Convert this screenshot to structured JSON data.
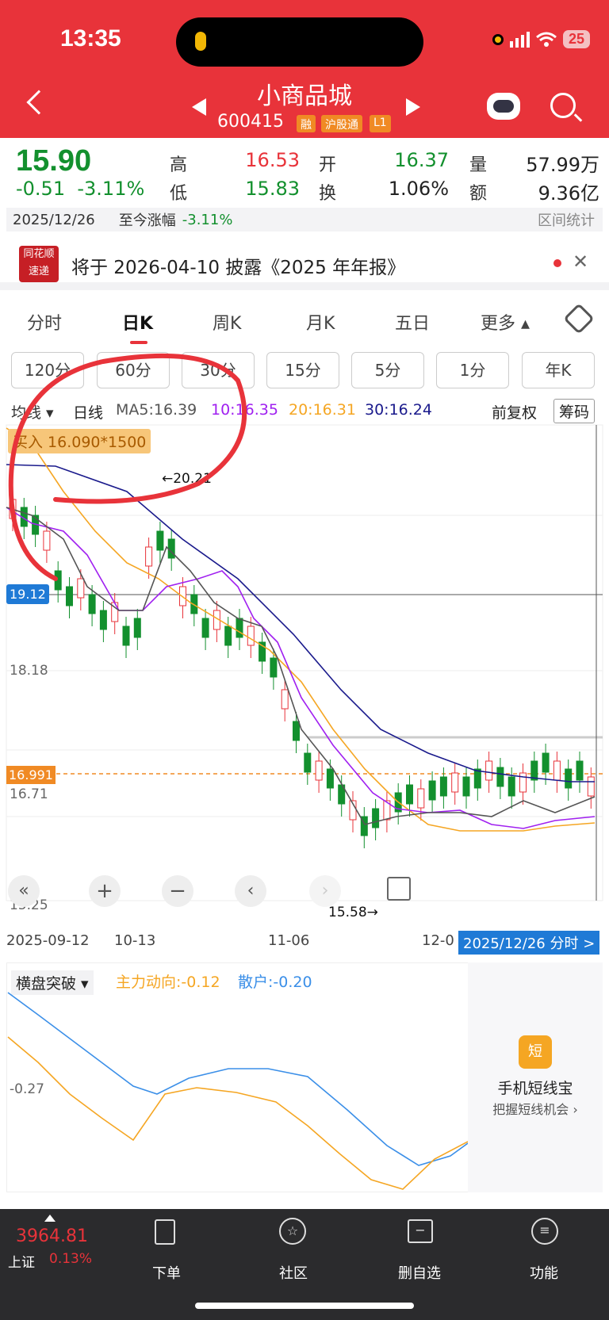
{
  "status": {
    "time": "13:35",
    "battery": "25"
  },
  "header": {
    "title": "小商品城",
    "code": "600415",
    "tags": [
      "融",
      "沪股通",
      "L1"
    ]
  },
  "quote": {
    "price": "15.90",
    "change": "-0.51",
    "change_pct": "-3.11%",
    "labels": {
      "high": "高",
      "low": "低",
      "open": "开",
      "turnover": "换",
      "volume": "量",
      "amount": "额"
    },
    "high": "16.53",
    "low": "15.83",
    "open": "16.37",
    "turnover": "1.06%",
    "volume": "57.99万",
    "amount": "9.36亿",
    "date": "2025/12/26",
    "to_date_label": "至今涨幅",
    "to_date_value": "-3.11%",
    "interval_stats": "区间统计"
  },
  "notice": {
    "logo_top": "同花顺",
    "logo_bottom": "速递",
    "text": "将于 2026-04-10 披露《2025 年年报》"
  },
  "tabs": [
    "分时",
    "日K",
    "周K",
    "月K",
    "五日",
    "更多"
  ],
  "periods": [
    "120分",
    "60分",
    "30分",
    "15分",
    "5分",
    "1分",
    "年K"
  ],
  "ma_bar": {
    "indicator": "均线",
    "line": "日线",
    "ma5": "MA5:16.39",
    "ma10": "10:16.35",
    "ma20": "20:16.31",
    "ma30": "30:16.24",
    "adjust": "前复权",
    "chips": "筹码"
  },
  "chart": {
    "buy_badge": "买入 16.090*1500",
    "high_marker": "←20.21",
    "low_marker": "15.58→",
    "price_tag": "19.12",
    "dash_tag": "16.991",
    "y_labels": [
      "18.18",
      "16.71",
      "15.25"
    ],
    "x_labels": [
      "2025-09-12",
      "10-13",
      "11-06",
      "12-0"
    ],
    "current_date_btn": "2025/12/26 分时 >"
  },
  "indicator": {
    "name": "横盘突破",
    "main": "主力动向:-0.12",
    "retail": "散户:-0.20",
    "y_label": "-0.27",
    "ad_title": "手机短线宝",
    "ad_sub": "把握短线机会 ›",
    "ad_icon": "短"
  },
  "colors": {
    "red": "#e8333a",
    "green": "#13902e",
    "ma5": "#555555",
    "ma10": "#a020f0",
    "ma20": "#f5a623",
    "ma30": "#1a1a8c"
  },
  "bottom": {
    "index_value": "3964.81",
    "index_name": "上证",
    "index_pct": "0.13%",
    "items": [
      "下单",
      "社区",
      "删自选",
      "功能"
    ]
  },
  "chart_data": {
    "type": "candlestick",
    "y_ticks": [
      18.18,
      16.71,
      15.25
    ],
    "marked_high": 20.21,
    "marked_low": 15.58,
    "last_close": 15.9
  }
}
